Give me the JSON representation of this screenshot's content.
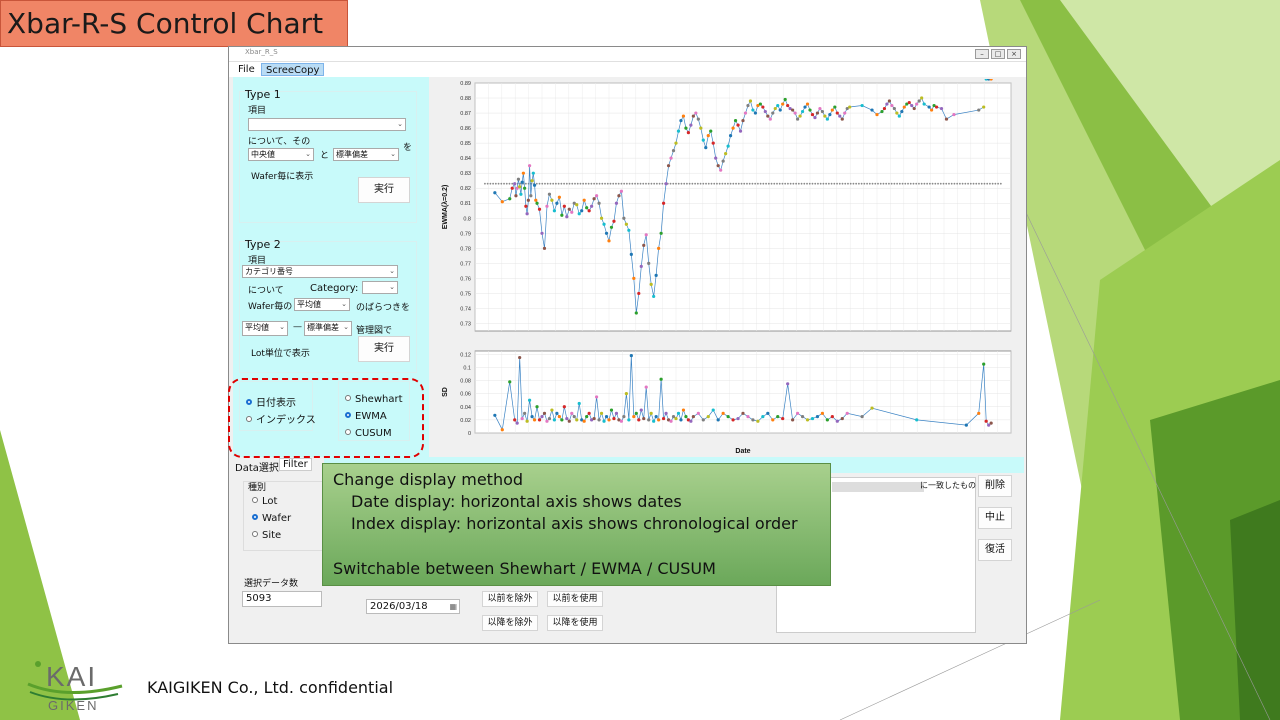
{
  "slide": {
    "title": "Xbar-R-S Control Chart",
    "footer": "KAIGIKEN Co., Ltd. confidential",
    "logo_text": "KAI",
    "logo_subtext": "GIKEN",
    "accent": "#f08566",
    "green": "#7cb342"
  },
  "window": {
    "title": "Xbar_R_S",
    "menu": [
      "File",
      "ScreeCopy"
    ]
  },
  "type1": {
    "title": "Type 1",
    "item_label": "項目",
    "item_value": "",
    "about_text": "について、その",
    "stat1": "中央値",
    "and_text": "と",
    "stat2": "標準偏差",
    "wo_text": "を",
    "wafer_text": "Wafer毎に表示",
    "run": "実行"
  },
  "type2": {
    "title": "Type 2",
    "item_label": "項目",
    "item_value": "カテゴリ番号",
    "about_text": "について",
    "category_label": "Category:",
    "category_value": "",
    "wafer_per": "Wafer毎の",
    "wafer_stat": "平均値",
    "variation_text": "のばらつきを",
    "stat_a": "平均値",
    "dash": "—",
    "stat_b": "標準偏差",
    "control_text": "管理図で",
    "lot_text": "Lot単位で表示",
    "run": "実行"
  },
  "display": {
    "axis_options": [
      "日付表示",
      "インデックス"
    ],
    "axis_selected": 0,
    "method_options": [
      "Shewhart",
      "EWMA",
      "CUSUM"
    ],
    "method_selected": 1
  },
  "tabs": [
    "Data選択",
    "Filter"
  ],
  "filter": {
    "kind_label": "種別",
    "kinds": [
      "Lot",
      "Wafer",
      "Site"
    ],
    "kind_selected": 1,
    "count_label": "選択データ数",
    "count_value": "5093",
    "date": "2026/03/18",
    "btn_before_exclude": "以前を除外",
    "btn_before_use": "以前を使用",
    "btn_after_exclude": "以降を除外",
    "btn_after_use": "以降を使用",
    "match_text": "に一致したもの",
    "delete": "削除",
    "stop": "中止",
    "restore": "復活"
  },
  "callout": {
    "line1": "Change display method",
    "line2": "Date display: horizontal axis shows dates",
    "line3": "Index display: horizontal axis shows chronological order",
    "line4": "Switchable between Shewhart / EWMA / CUSUM"
  },
  "chart_data": [
    {
      "type": "line",
      "ylabel": "EWMA(λ=0.2)",
      "ylim": [
        0.725,
        0.89
      ],
      "yticks": [
        0.73,
        0.74,
        0.75,
        0.76,
        0.77,
        0.78,
        0.79,
        0.8,
        0.81,
        0.82,
        0.83,
        0.84,
        0.85,
        0.86,
        0.87,
        0.88,
        0.89
      ],
      "x": [
        0,
        3,
        6,
        7,
        8,
        8.5,
        9,
        9.5,
        10,
        10.5,
        11,
        11.5,
        12,
        12.5,
        13,
        13.5,
        14,
        14.5,
        15,
        15.5,
        16,
        16.5,
        17,
        18,
        19,
        20,
        21,
        22,
        23,
        24,
        25,
        26,
        27,
        28,
        29,
        30,
        31,
        32,
        33,
        34,
        35,
        36,
        37,
        38,
        39,
        40,
        41,
        42,
        43,
        44,
        45,
        46,
        47,
        48,
        49,
        50,
        51,
        52,
        53,
        54,
        55,
        56,
        57,
        58,
        59,
        60,
        61,
        62,
        63,
        64,
        65,
        66,
        67,
        68,
        69,
        70,
        71,
        72,
        73,
        74,
        75,
        76,
        77,
        78,
        79,
        80,
        81,
        82,
        83,
        84,
        85,
        86,
        87,
        88,
        89,
        90,
        91,
        92,
        93,
        94,
        95,
        96,
        97,
        98,
        99,
        100,
        101,
        102,
        103,
        104,
        105,
        106,
        107,
        108,
        109,
        110,
        111,
        112,
        113,
        114,
        115,
        116,
        117,
        118,
        119,
        120,
        121,
        122,
        123,
        124,
        125,
        126,
        127,
        128,
        129,
        130,
        131,
        132,
        133,
        134,
        135,
        136,
        137,
        138,
        139,
        140,
        141,
        142,
        143,
        148,
        152,
        154,
        156,
        157,
        158,
        159,
        160,
        161,
        162,
        163,
        164,
        165,
        166,
        167,
        168,
        169,
        170,
        171,
        172,
        173,
        175,
        176,
        177,
        178,
        180,
        182,
        185,
        195,
        197,
        198,
        199,
        200
      ],
      "series": [
        {
          "values": [
            0.817,
            0.811,
            0.813,
            0.82,
            0.823,
            0.815,
            0.82,
            0.826,
            0.821,
            0.816,
            0.824,
            0.83,
            0.82,
            0.808,
            0.803,
            0.812,
            0.835,
            0.815,
            0.825,
            0.83,
            0.822,
            0.812,
            0.81,
            0.806,
            0.79,
            0.78,
            0.808,
            0.816,
            0.812,
            0.805,
            0.81,
            0.814,
            0.802,
            0.808,
            0.801,
            0.806,
            0.804,
            0.81,
            0.809,
            0.803,
            0.805,
            0.812,
            0.807,
            0.805,
            0.808,
            0.813,
            0.815,
            0.81,
            0.8,
            0.796,
            0.79,
            0.785,
            0.794,
            0.798,
            0.81,
            0.815,
            0.818,
            0.8,
            0.796,
            0.792,
            0.776,
            0.76,
            0.737,
            0.75,
            0.768,
            0.782,
            0.789,
            0.77,
            0.756,
            0.748,
            0.762,
            0.78,
            0.79,
            0.81,
            0.823,
            0.835,
            0.84,
            0.845,
            0.85,
            0.858,
            0.865,
            0.868,
            0.86,
            0.857,
            0.862,
            0.868,
            0.87,
            0.866,
            0.86,
            0.852,
            0.847,
            0.855,
            0.858,
            0.85,
            0.84,
            0.835,
            0.832,
            0.838,
            0.843,
            0.848,
            0.855,
            0.86,
            0.865,
            0.862,
            0.858,
            0.865,
            0.87,
            0.875,
            0.878,
            0.872,
            0.87,
            0.875,
            0.876,
            0.874,
            0.871,
            0.868,
            0.866,
            0.87,
            0.873,
            0.875,
            0.872,
            0.876,
            0.879,
            0.875,
            0.873,
            0.872,
            0.87,
            0.866,
            0.868,
            0.871,
            0.874,
            0.876,
            0.872,
            0.869,
            0.867,
            0.87,
            0.873,
            0.871,
            0.868,
            0.866,
            0.869,
            0.872,
            0.874,
            0.87,
            0.868,
            0.866,
            0.87,
            0.873,
            0.874,
            0.875,
            0.872,
            0.869,
            0.871,
            0.873,
            0.876,
            0.878,
            0.875,
            0.873,
            0.87,
            0.868,
            0.871,
            0.874,
            0.876,
            0.877,
            0.875,
            0.873,
            0.876,
            0.878,
            0.88,
            0.876,
            0.874,
            0.872,
            0.875,
            0.874,
            0.873,
            0.866,
            0.869,
            0.872,
            0.874
          ]
        }
      ],
      "reference_line": 0.823,
      "grid": true
    },
    {
      "type": "line",
      "ylabel": "SD",
      "xlabel": "Date",
      "ylim": [
        0,
        0.125
      ],
      "yticks": [
        0,
        0.02,
        0.04,
        0.06,
        0.08,
        0.1,
        0.12
      ],
      "x": [
        0,
        3,
        6,
        8,
        9,
        10,
        11,
        12,
        13,
        14,
        15,
        16,
        17,
        18,
        19,
        20,
        21,
        22,
        23,
        24,
        25,
        26,
        27,
        28,
        29,
        30,
        31,
        32,
        33,
        34,
        35,
        36,
        37,
        38,
        39,
        40,
        41,
        42,
        43,
        44,
        45,
        46,
        47,
        48,
        49,
        50,
        51,
        52,
        53,
        54,
        55,
        56,
        57,
        58,
        59,
        60,
        61,
        62,
        63,
        64,
        65,
        66,
        67,
        68,
        69,
        70,
        71,
        72,
        73,
        74,
        75,
        76,
        77,
        78,
        79,
        80,
        82,
        84,
        86,
        88,
        90,
        92,
        94,
        96,
        98,
        100,
        102,
        104,
        106,
        108,
        110,
        112,
        114,
        116,
        118,
        120,
        122,
        124,
        126,
        128,
        130,
        132,
        134,
        136,
        138,
        140,
        142,
        148,
        152,
        170,
        190,
        195,
        197,
        198,
        199,
        200
      ],
      "series": [
        {
          "values": [
            0.027,
            0.005,
            0.078,
            0.02,
            0.015,
            0.115,
            0.022,
            0.03,
            0.018,
            0.05,
            0.025,
            0.02,
            0.04,
            0.02,
            0.025,
            0.03,
            0.018,
            0.022,
            0.035,
            0.02,
            0.03,
            0.025,
            0.02,
            0.04,
            0.022,
            0.018,
            0.03,
            0.025,
            0.02,
            0.045,
            0.02,
            0.018,
            0.025,
            0.03,
            0.02,
            0.022,
            0.055,
            0.02,
            0.03,
            0.018,
            0.025,
            0.02,
            0.035,
            0.022,
            0.03,
            0.02,
            0.018,
            0.025,
            0.06,
            0.02,
            0.118,
            0.025,
            0.03,
            0.02,
            0.035,
            0.022,
            0.07,
            0.02,
            0.03,
            0.018,
            0.025,
            0.02,
            0.082,
            0.022,
            0.03,
            0.02,
            0.018,
            0.025,
            0.022,
            0.03,
            0.02,
            0.035,
            0.025,
            0.02,
            0.018,
            0.025,
            0.03,
            0.02,
            0.025,
            0.035,
            0.02,
            0.03,
            0.025,
            0.02,
            0.022,
            0.03,
            0.025,
            0.02,
            0.018,
            0.025,
            0.03,
            0.02,
            0.025,
            0.022,
            0.075,
            0.02,
            0.03,
            0.025,
            0.02,
            0.022,
            0.025,
            0.03,
            0.02,
            0.025,
            0.018,
            0.022,
            0.03,
            0.025,
            0.038,
            0.02,
            0.012,
            0.03,
            0.105,
            0.018,
            0.012,
            0.015
          ]
        }
      ],
      "grid": true
    }
  ]
}
